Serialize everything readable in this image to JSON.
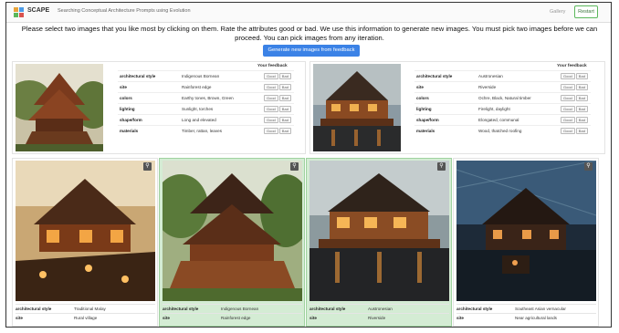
{
  "header": {
    "app_title": "SCAPE",
    "app_subtitle": "Searching Conceptual Architecture Prompts using Evolution",
    "gallery_label": "Gallery",
    "restart_label": "Restart"
  },
  "instructions": "Please select two images that you like most by clicking on them. Rate the attributes good or bad. We use this information to generate new images. You must pick two images before we can proceed. You can pick images from any iteration.",
  "generate_button": "Generate new images from feedback",
  "feedback_labels": {
    "heading": "Your feedback",
    "good": "Good",
    "bad": "Bad"
  },
  "selected": [
    {
      "attributes": [
        {
          "key": "architectural style",
          "value": "Indigenous Bornean"
        },
        {
          "key": "site",
          "value": "Rainforest edge"
        },
        {
          "key": "colors",
          "value": "Earthy tones, Brown, Green"
        },
        {
          "key": "lighting",
          "value": "Sunlight, torches"
        },
        {
          "key": "shape/form",
          "value": "Long and elevated"
        },
        {
          "key": "materials",
          "value": "Timber, rattan, leaves"
        }
      ]
    },
    {
      "attributes": [
        {
          "key": "architectural style",
          "value": "Austronesian"
        },
        {
          "key": "site",
          "value": "Riverside"
        },
        {
          "key": "colors",
          "value": "Ochre, Black, Natural timber"
        },
        {
          "key": "lighting",
          "value": "Firelight, daylight"
        },
        {
          "key": "shape/form",
          "value": "Elongated, communal"
        },
        {
          "key": "materials",
          "value": "Wood, thatched roofing"
        }
      ]
    }
  ],
  "gallery": [
    {
      "selected": false,
      "attributes": [
        {
          "key": "architectural style",
          "value": "Traditional Malay"
        },
        {
          "key": "site",
          "value": "Rural village"
        }
      ]
    },
    {
      "selected": true,
      "attributes": [
        {
          "key": "architectural style",
          "value": "Indigenous Bornean"
        },
        {
          "key": "site",
          "value": "Rainforest edge"
        }
      ]
    },
    {
      "selected": true,
      "attributes": [
        {
          "key": "architectural style",
          "value": "Austronesian"
        },
        {
          "key": "site",
          "value": "Riverside"
        }
      ]
    },
    {
      "selected": false,
      "attributes": [
        {
          "key": "architectural style",
          "value": "Southeast Asian vernacular"
        },
        {
          "key": "site",
          "value": "Near agricultural lands"
        }
      ]
    }
  ],
  "icons": {
    "zoom": "magnifier-icon",
    "logo": "scape-logo-icon"
  },
  "colors": {
    "accent": "#3b82e6",
    "selected_bg": "#d4ecd4",
    "restart_border": "#5cb85c"
  }
}
